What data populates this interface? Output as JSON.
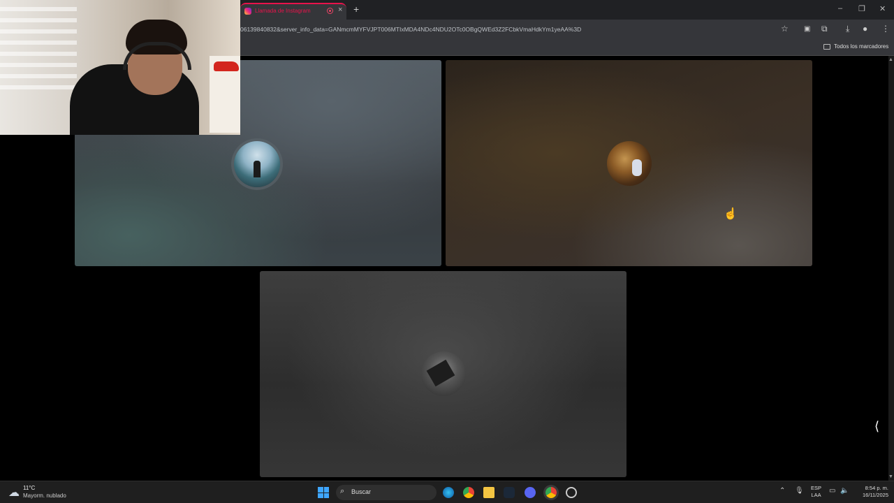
{
  "browser": {
    "tab_title": "Llamada de Instagram",
    "url": "06139840832&server_info_data=GANmcmMYFVJPT006MTIxMDA4NDc4NDU2OTc0OBgQWEd3Z2FCbkVmaHdkYm1yeAA%3D",
    "bookmarks_folder_label": "Todos los marcadores"
  },
  "call": {
    "participants": [
      {
        "avatar": "participant-1-avatar"
      },
      {
        "avatar": "participant-2-avatar"
      },
      {
        "avatar": "participant-3-avatar"
      }
    ]
  },
  "taskbar": {
    "weather_temp": "11°C",
    "weather_condition": "Mayorm. nublado",
    "search_placeholder": "Buscar",
    "lang_top": "ESP",
    "lang_bottom": "LAA",
    "time": "8:54 p. m.",
    "date": "16/11/2025"
  },
  "icons": [
    "instagram-icon",
    "record-icon",
    "close-icon",
    "new-tab-icon",
    "star-icon",
    "extensions-icon",
    "download-icon",
    "profile-icon",
    "menu-icon",
    "folder-icon",
    "cursor-icon",
    "side-panel-icon",
    "weather-icon",
    "windows-icon",
    "search-icon",
    "edge-icon",
    "chrome-icon",
    "file-explorer-icon",
    "steam-icon",
    "discord-icon"
  ]
}
